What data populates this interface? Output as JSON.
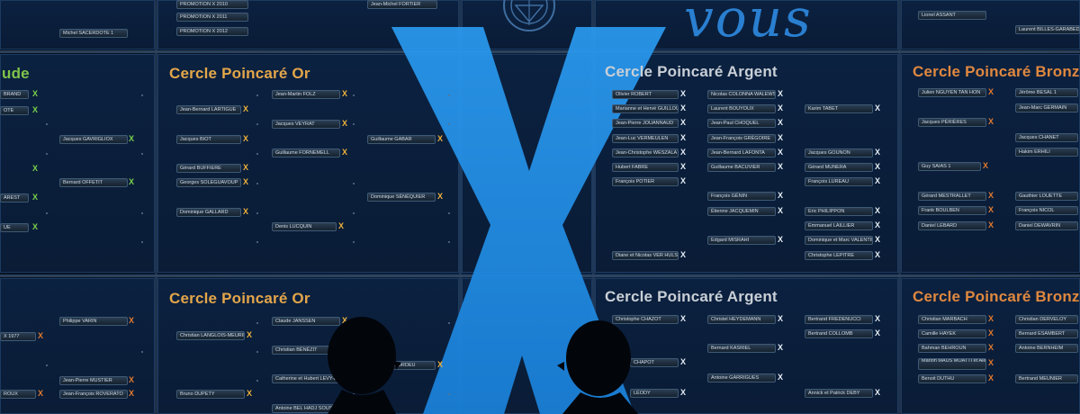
{
  "scene": {
    "description_colors": {
      "background": "#08182f",
      "big_x": "#1f8fe5",
      "vous": "#2a7fd0",
      "or": "#e3a64a",
      "argent": "#c9cfd6",
      "bronze": "#e0883f",
      "green": "#7fc44b"
    }
  },
  "top_text": {
    "word": "vous"
  },
  "top_row": {
    "left_plates": [
      "PROMOTION X 2010",
      "PROMOTION X 2011",
      "PROMOTION X 2012",
      "Michel SACERDOTE 1"
    ],
    "center_plates": [
      "Jean-Michel FORTIER"
    ],
    "right_plates": [
      "Lionel ASSANT",
      "Laurent BILLES-GARABEDIAN"
    ]
  },
  "row1": {
    "panel_a": {
      "heading": "ude",
      "plates": [
        "BRAND",
        "OTE",
        "",
        "",
        "Jacques GAVRIGLIOX",
        "Bernard OFFETIT",
        "AREST",
        "UE"
      ]
    },
    "panel_b": {
      "heading": "Cercle Poincaré Or",
      "plates": [
        "Jean-Martin FOLZ",
        "Jean-Bernard LARTIGUE",
        "Jacques VEYRAT",
        "Jacques BIOT",
        "Guillaume FORNEMELL",
        "Guillaume GABAR",
        "Gérard BUFFIERE",
        "Georges SOLEGUAVOUP",
        "Dominique SÉNÉQUIER",
        "Dominique GALLARD",
        "Denis LUCQUIN"
      ]
    },
    "panel_c": {
      "heading": "Cercle Poincaré Argent",
      "plates": [
        "Olivier ROBERT",
        "Nicolas COLONNA WALEWSKI",
        "Marianne et Hervé GUILLOU",
        "Laurent BOUYOUX",
        "Karim TABET",
        "Jean-Pierre JOUANNAUD",
        "Jean-Paul CHOQUEL",
        "Jean-Luc VERMEULEN",
        "Jean-François GRÉGOIRE",
        "Jean-Christophe WESZALA",
        "Jean-Bernard LAFONTA",
        "Jacques GOUNON",
        "Hubert FABRE",
        "Guillaume BACUVIER",
        "Gérard MUNERA",
        "François POTIER",
        "François LUREAU",
        "François GÉNIN",
        "Étienne JACQUEMIN",
        "Eric PHILIPPON",
        "Emmanuel LAILLIER",
        "Edgard MISRAHI",
        "Dominique et Marc VALENTIN",
        "Diane et Nicolas VER HULST",
        "Christophe LEPITRE"
      ]
    },
    "panel_d": {
      "heading": "Cercle Poincaré Bronze",
      "plates": [
        "Julien NGUYEN TAN HON",
        "Jérôme BESAL 1",
        "Jean-Marc GERMAIN",
        "Jacques PÉRIÈRES",
        "Jacques CHANET",
        "Hakim ERHILI",
        "Guy SAIAS 1",
        "Gérard MESTRALLET",
        "Gauthier LOUETTE",
        "Frank BOULBEN",
        "François NICOL",
        "Daniel LEBARD",
        "Daniel DEWAVRIN"
      ]
    }
  },
  "row2": {
    "panel_a": {
      "heading": "",
      "plates": [
        "Philippe VARIN",
        "X 1977",
        "Jean-Pierre MUSTIER",
        "Jean-François ROVERATO",
        "ROUX"
      ]
    },
    "panel_b": {
      "heading": "Cercle Poincaré Or",
      "plates": [
        "Claude JANSSEN",
        "Christian LANGLOIS-MEURINNE",
        "Christian BÉNÉZIT",
        "Catherine et Hubert LEVY-LAMBERT",
        "BOURDEU",
        "Bruno DUPETY",
        "Antoine BEL HADJ SOUSI"
      ]
    },
    "panel_c": {
      "heading": "Cercle Poincaré Argent",
      "plates": [
        "Christophe CHAZOT",
        "Christel HEYDEMANN",
        "Bertrand FREDENUCCI",
        "Bertrand COLLOMB",
        "Bernard KASRIEL",
        "CHAPOT",
        "Antoine GARRIGUES",
        "LÉODY",
        "Annick et Patrick DEBY"
      ]
    },
    "panel_d": {
      "heading": "Cercle Poincaré Bronze",
      "plates": [
        "Christian MARBACH",
        "Christian DERVELOY",
        "Camille HAYEK",
        "Bernard ESAMBERT",
        "Bahman BEHROUN",
        "Antoine BERNHEIM",
        "Marion MAUS MOATTI et Alexandre MOATTI",
        "Benoit DUTHU",
        "Bertrand MEUNIER"
      ]
    }
  }
}
